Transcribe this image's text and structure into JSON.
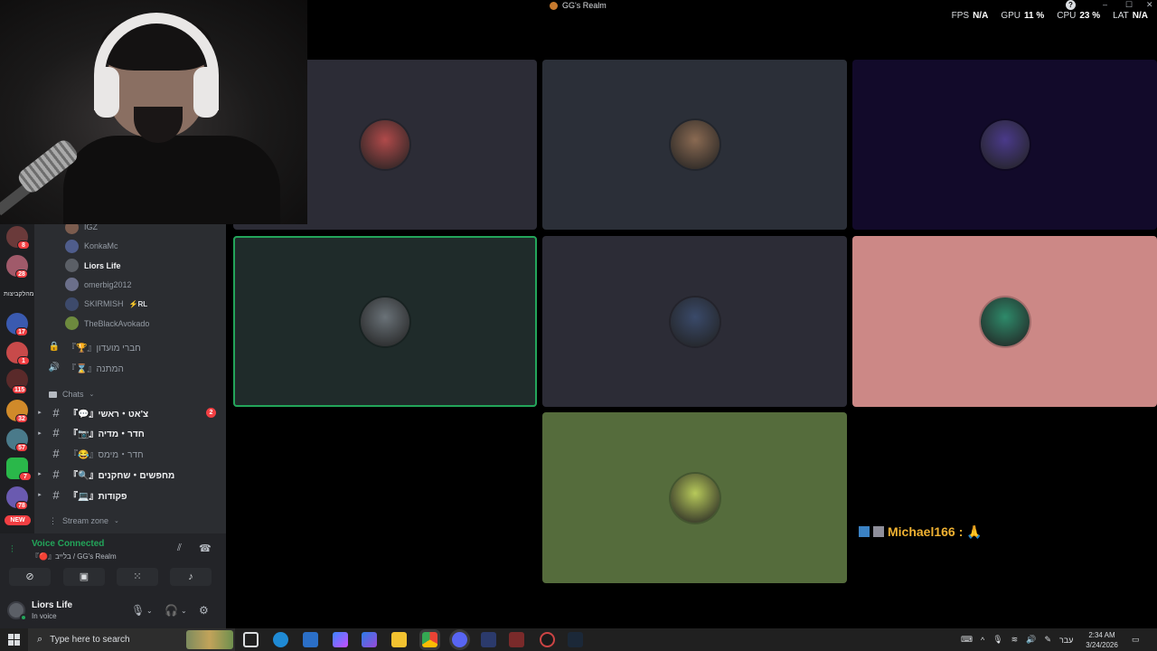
{
  "window": {
    "title": "GG's Realm",
    "controls": [
      "–",
      "☐",
      "✕"
    ]
  },
  "stats": {
    "fps_label": "FPS",
    "fps_value": "N/A",
    "gpu_label": "GPU",
    "gpu_value": "11 %",
    "cpu_label": "CPU",
    "cpu_value": "23 %",
    "lat_label": "LAT",
    "lat_value": "N/A"
  },
  "server_rail": {
    "badges": [
      "8",
      "28",
      "17",
      "1",
      "115",
      "32",
      "57",
      "7",
      "78"
    ],
    "label": "מהלקביצות",
    "new_label": "NEW"
  },
  "voice_members": [
    {
      "name": "IGZ",
      "active": false,
      "color": "#7b5c4e"
    },
    {
      "name": "KonkaMc",
      "active": false,
      "color": "#4f5d8c"
    },
    {
      "name": "Liors Life",
      "active": true,
      "color": "#5b5f66"
    },
    {
      "name": "omerbig2012",
      "active": false,
      "color": "#6b6f8a"
    },
    {
      "name": "SKIRMISH",
      "tag": "⚡RL",
      "active": false,
      "color": "#3d4a6b"
    },
    {
      "name": "TheBlackAvokado",
      "active": false,
      "color": "#6d8a3e"
    }
  ],
  "locked_channels": [
    {
      "icon": "🔒",
      "name": "『🏆』חברי מועדון"
    },
    {
      "icon": "🔊",
      "name": "『⌛』המתנה"
    }
  ],
  "categories": {
    "chats": "Chats",
    "stream": "Stream zone"
  },
  "text_channels": [
    {
      "name": "『💬』צ'אט・ראשי",
      "unread": "2",
      "bright": true,
      "caret": true
    },
    {
      "name": "『📷』חדר・מדיה",
      "unread": "",
      "bright": true,
      "caret": true
    },
    {
      "name": "『😂』חדר・מימס",
      "unread": "",
      "bright": false,
      "caret": false
    },
    {
      "name": "『🔍』מחפשים・שחקנים",
      "unread": "",
      "bright": true,
      "caret": true
    },
    {
      "name": "『💻』פקודות",
      "unread": "",
      "bright": true,
      "caret": true
    }
  ],
  "voice_panel": {
    "title": "Voice Connected",
    "subtitle": "『🔴』בלייב / GG's Realm"
  },
  "user_panel": {
    "name": "Liors Life",
    "status": "In voice"
  },
  "tiles": [
    {
      "bg": "#2c2c36",
      "avatar": "#b04a4a",
      "speaking": false
    },
    {
      "bg": "#2b2f38",
      "avatar": "#8a6a52",
      "speaking": false
    },
    {
      "bg": "#120a2a",
      "avatar": "#4a3a8a",
      "speaking": false
    },
    {
      "bg": "#1f2b2a",
      "avatar": "#6a7278",
      "speaking": true
    },
    {
      "bg": "#2c2c36",
      "avatar": "#3a4a6a",
      "speaking": false
    },
    {
      "bg": "#cc8886",
      "avatar": "#2e8a6a",
      "speaking": false
    },
    {
      "bg": "#556c3c",
      "avatar": "#b7c95a",
      "speaking": false
    }
  ],
  "chat_overlay": {
    "user": "Michael166",
    "separator": ":",
    "message": "🙏"
  },
  "taskbar": {
    "search_placeholder": "Type here to search",
    "language": "עבר",
    "time": "2:34 AM",
    "date": "3/24/2026"
  }
}
